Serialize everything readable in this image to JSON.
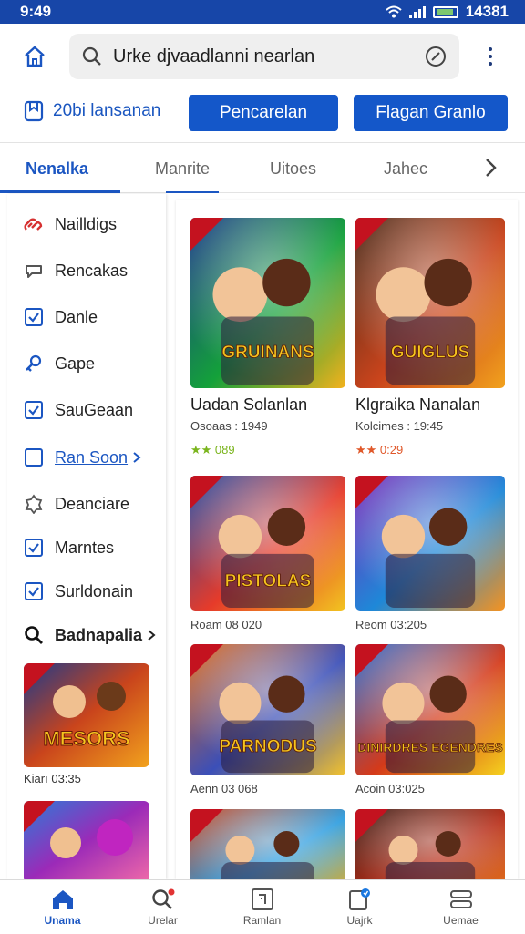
{
  "status": {
    "time": "9:49",
    "right_text": "14381"
  },
  "search": {
    "value": "Urke djvaadlanni nearlan"
  },
  "actions": {
    "label": "20bi lansanan",
    "primary": "Pencarelan",
    "secondary": "Flagan Granlo"
  },
  "tabs": [
    "Nenalka",
    "Manrite",
    "Uitoes",
    "Jahec"
  ],
  "sidebar": {
    "items": [
      {
        "label": "Nailldigs",
        "icon": "link-icon"
      },
      {
        "label": "Rencakas",
        "icon": "chat-icon"
      },
      {
        "label": "Danle",
        "icon": "checkbox-icon"
      },
      {
        "label": "Gape",
        "icon": "puzzle-icon"
      },
      {
        "label": "SauGeaan",
        "icon": "checkbox-icon"
      },
      {
        "label": "Ran Soon",
        "icon": "square-icon"
      },
      {
        "label": "Deanciare",
        "icon": "badge-icon"
      },
      {
        "label": "Marntes",
        "icon": "checkbox-icon"
      },
      {
        "label": "Surldonain",
        "icon": "checkbox-icon"
      },
      {
        "label": "Badnapalia",
        "icon": "search-icon"
      }
    ],
    "thumb_caption": "Kiarı 03:35",
    "thumb_title": "MESORS"
  },
  "cards": [
    {
      "title": "Uadan Solanlan",
      "sub": "Osoaas : 1949",
      "stars": "★★ 089",
      "art": "GRUINANS",
      "colors": [
        "#14a13a",
        "#1c3a8a",
        "#f3b21d"
      ]
    },
    {
      "title": "Klgraika Nanalan",
      "sub": "Kolcimes : 19:45",
      "stars": "★★ 0:29",
      "art": "GUIGLUS",
      "colors": [
        "#c9441c",
        "#4a2b1a",
        "#f2a21d"
      ]
    },
    {
      "title": "",
      "sub": "Roam 08 020",
      "stars": "",
      "art": "PISTOLAS",
      "colors": [
        "#e63b2a",
        "#1f4aa5",
        "#f2c420"
      ]
    },
    {
      "title": "",
      "sub": "Reom 03:205",
      "stars": "",
      "art": "",
      "colors": [
        "#1e88d8",
        "#7b2ab8",
        "#f59320"
      ]
    },
    {
      "title": "",
      "sub": "Aenn 03 068",
      "stars": "",
      "art": "PARNODUS",
      "colors": [
        "#3b4fb8",
        "#e06a1a",
        "#f2c22d"
      ]
    },
    {
      "title": "",
      "sub": "Acoin 03:025",
      "stars": "",
      "art": "DINIRDRES EGENDRES",
      "colors": [
        "#d43a1a",
        "#2a6ad0",
        "#f5d21e"
      ]
    },
    {
      "title": "",
      "sub": "",
      "stars": "",
      "art": "",
      "colors": [
        "#2f9ee0",
        "#c9441c",
        "#f2b21d"
      ]
    },
    {
      "title": "",
      "sub": "",
      "stars": "",
      "art": "",
      "colors": [
        "#b8311c",
        "#3a1a12",
        "#e87a1d"
      ]
    }
  ],
  "bottom_nav": [
    {
      "label": "Unama",
      "icon": "home-icon"
    },
    {
      "label": "Urelar",
      "icon": "search-icon"
    },
    {
      "label": "Ramlan",
      "icon": "document-icon"
    },
    {
      "label": "Uajrk",
      "icon": "bookmark-icon"
    },
    {
      "label": "Uemae",
      "icon": "menu-icon"
    }
  ],
  "accent": "#1b56c2",
  "status_bar_color": "#1746a8"
}
